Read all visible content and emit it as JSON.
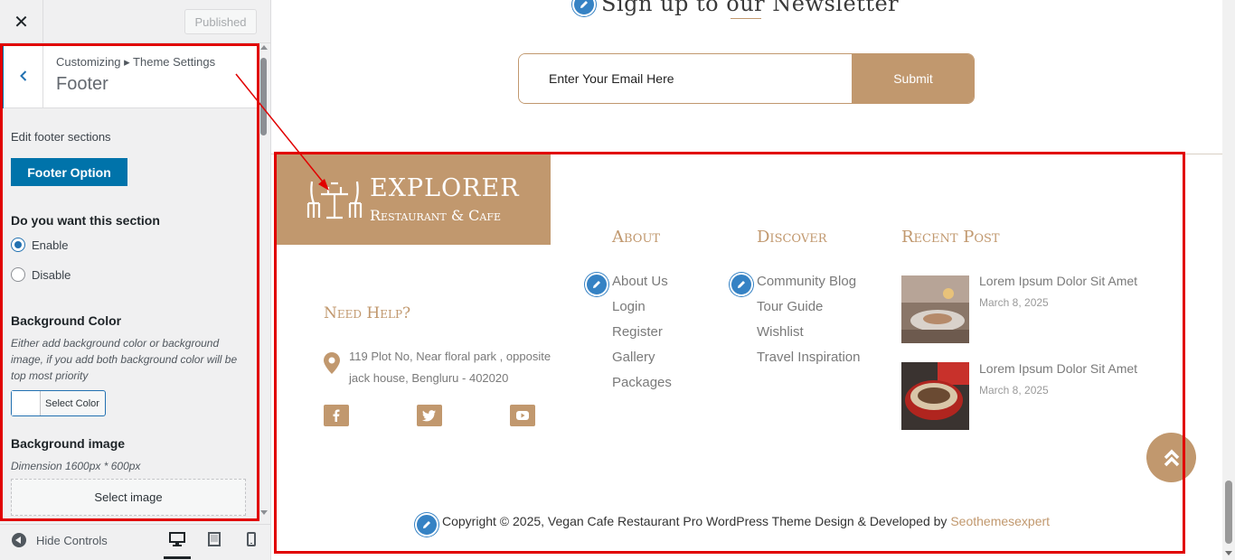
{
  "customizer": {
    "close_icon": "close-icon",
    "publish_label": "Published",
    "breadcrumb": "Customizing ▸ Theme Settings",
    "section_title": "Footer",
    "edit_sections_label": "Edit footer sections",
    "footer_option_label": "Footer Option",
    "section_question": "Do you want this section",
    "radio_enable": "Enable",
    "radio_disable": "Disable",
    "radio_selected": "Enable",
    "bg_color_label": "Background Color",
    "bg_color_desc": "Either add background color or background image, if you add both background color will be top most priority",
    "select_color_label": "Select Color",
    "bg_image_label": "Background image",
    "bg_image_dimension": "Dimension 1600px * 600px",
    "select_image_label": "Select image",
    "hide_controls_label": "Hide Controls",
    "devices": [
      "desktop",
      "tablet",
      "mobile"
    ],
    "active_device": "desktop"
  },
  "preview": {
    "newsletter_title": "Sign up to our Newsletter",
    "email_placeholder": "Enter Your Email Here",
    "submit_label": "Submit",
    "logo_name": "EXPLORER",
    "logo_tagline": "Restaurant & Cafe",
    "need_help_heading": "Need Help?",
    "address": "119 Plot No, Near floral park , opposite jack house, Bengluru - 402020",
    "social": [
      "facebook-icon",
      "twitter-icon",
      "youtube-icon"
    ],
    "about": {
      "heading": "About",
      "links": [
        "About Us",
        "Login",
        "Register",
        "Gallery",
        "Packages"
      ]
    },
    "discover": {
      "heading": "Discover",
      "links": [
        "Community Blog",
        "Tour Guide",
        "Wishlist",
        "Travel Inspiration"
      ]
    },
    "recent": {
      "heading": "Recent Post",
      "posts": [
        {
          "title": "Lorem Ipsum Dolor Sit Amet",
          "date": "March 8, 2025"
        },
        {
          "title": "Lorem Ipsum Dolor Sit Amet",
          "date": "March 8, 2025"
        }
      ]
    },
    "copyright_text": "Copyright © 2025, Vegan Cafe Restaurant Pro WordPress Theme Design & Developed by",
    "copyright_brand": "Seothemesexpert"
  },
  "colors": {
    "accent": "#c1986e",
    "wp_blue": "#0073aa",
    "highlight_red": "#e10000",
    "edit_pencil": "#3582c4"
  }
}
